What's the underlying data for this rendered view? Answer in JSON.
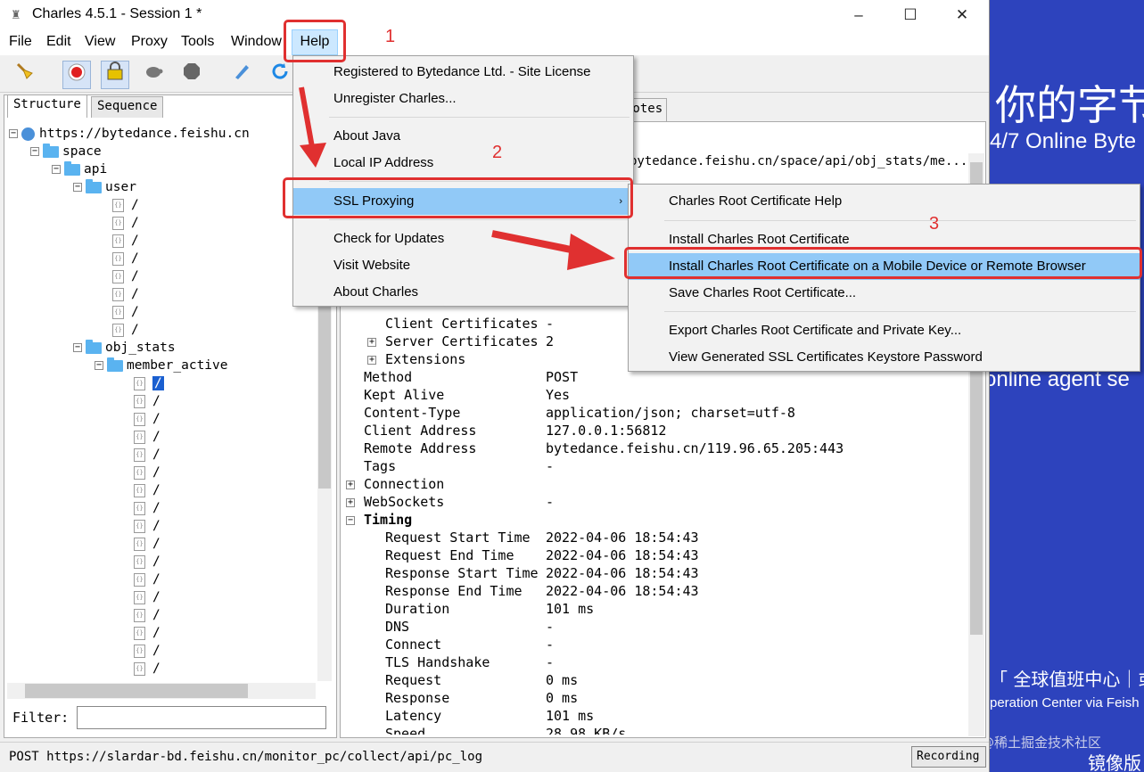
{
  "window": {
    "title": "Charles 4.5.1 - Session 1 *",
    "minimize": "–",
    "maximize": "☐",
    "close": "✕"
  },
  "menubar": [
    "File",
    "Edit",
    "View",
    "Proxy",
    "Tools",
    "Window",
    "Help"
  ],
  "structure_tabs": [
    "Structure",
    "Sequence"
  ],
  "tree": {
    "host": "https://bytedance.feishu.cn",
    "space": "space",
    "api": "api",
    "user": "user",
    "obj_stats": "obj_stats",
    "member_active": "member_active",
    "leaf": "/"
  },
  "filter_label": "Filter:",
  "right_tab": "Notes",
  "url_line": "bytedance.feishu.cn/space/api/obj_stats/me...",
  "detail_rows": [
    {
      "key": "Client Certificates",
      "value": "-",
      "indent": 2
    },
    {
      "key": "Server Certificates",
      "value": "2",
      "indent": 2,
      "expander": "+"
    },
    {
      "key": "Extensions",
      "value": "",
      "indent": 2,
      "expander": "+"
    },
    {
      "key": "Method",
      "value": "POST",
      "indent": 1
    },
    {
      "key": "Kept Alive",
      "value": "Yes",
      "indent": 1
    },
    {
      "key": "Content-Type",
      "value": "application/json; charset=utf-8",
      "indent": 1
    },
    {
      "key": "Client Address",
      "value": "127.0.0.1:56812",
      "indent": 1
    },
    {
      "key": "Remote Address",
      "value": "bytedance.feishu.cn/119.96.65.205:443",
      "indent": 1
    },
    {
      "key": "Tags",
      "value": "-",
      "indent": 1
    },
    {
      "key": "Connection",
      "value": "",
      "indent": 1,
      "expander": "+"
    },
    {
      "key": "WebSockets",
      "value": "-",
      "indent": 1,
      "expander": "+"
    },
    {
      "key": "Timing",
      "value": "",
      "indent": 1,
      "expander": "−",
      "bold": true
    },
    {
      "key": "Request Start Time",
      "value": "2022-04-06 18:54:43",
      "indent": 2
    },
    {
      "key": "Request End Time",
      "value": "2022-04-06 18:54:43",
      "indent": 2
    },
    {
      "key": "Response Start Time",
      "value": "2022-04-06 18:54:43",
      "indent": 2
    },
    {
      "key": "Response End Time",
      "value": "2022-04-06 18:54:43",
      "indent": 2
    },
    {
      "key": "Duration",
      "value": "101 ms",
      "indent": 2
    },
    {
      "key": "DNS",
      "value": "-",
      "indent": 2
    },
    {
      "key": "Connect",
      "value": "-",
      "indent": 2
    },
    {
      "key": "TLS Handshake",
      "value": "-",
      "indent": 2
    },
    {
      "key": "Request",
      "value": "0 ms",
      "indent": 2
    },
    {
      "key": "Response",
      "value": "0 ms",
      "indent": 2
    },
    {
      "key": "Latency",
      "value": "101 ms",
      "indent": 2
    },
    {
      "key": "Speed",
      "value": "28.98 KB/s",
      "indent": 2
    }
  ],
  "status": {
    "text": "POST https://slardar-bd.feishu.cn/monitor_pc/collect/api/pc_log",
    "recording": "Recording"
  },
  "help_menu": {
    "items": [
      "Registered to Bytedance Ltd. - Site License",
      "Unregister Charles...",
      "About Java",
      "Local IP Address",
      "SSL Proxying",
      "Check for Updates",
      "Visit Website",
      "About Charles"
    ]
  },
  "ssl_menu": {
    "items": [
      "Charles Root Certificate Help",
      "Install Charles Root Certificate",
      "Install Charles Root Certificate on a Mobile Device or Remote Browser",
      "Save Charles Root Certificate...",
      "Export Charles Root Certificate and Private Key...",
      "View Generated SSL Certificates Keystore Password"
    ]
  },
  "annotations": {
    "step1": "1",
    "step2": "2",
    "step3": "3",
    "color": "#e03030"
  },
  "background": {
    "line1": "你的字节",
    "line2": "4/7 Online Byte",
    "line3": "online agent se",
    "line4": "「 全球值班中心｜或",
    "line5": "peration Center via Feish",
    "line6": "镜像版",
    "watermark": "@稀土掘金技术社区"
  },
  "icons": [
    "broom-icon",
    "record-icon",
    "throttle-icon",
    "turtle-icon",
    "stop-icon",
    "pen-icon",
    "refresh-icon"
  ]
}
